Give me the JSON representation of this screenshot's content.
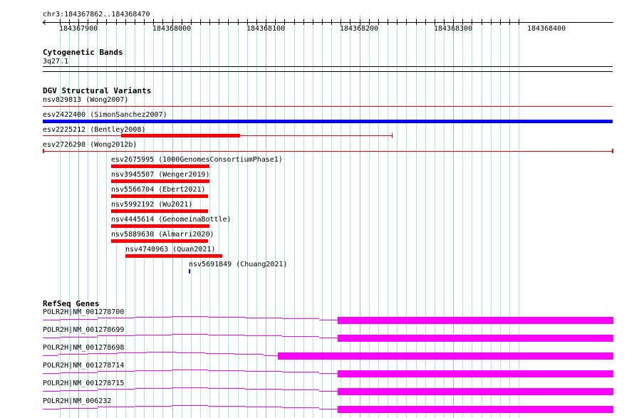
{
  "ruler": {
    "location": "chr3:184367862..184368470",
    "ticks": [
      "184367900",
      "184368000",
      "184368100",
      "184368200",
      "184368300",
      "184368400"
    ]
  },
  "cytobands": {
    "title": "Cytogenetic Bands",
    "band": "3q27.1"
  },
  "dgv": {
    "title": "DGV Structural Variants",
    "items": [
      {
        "label": "nsv829813 (Wong2007)",
        "color": "#ff0000"
      },
      {
        "label": "esv2422400 (SimonSanchez2007)",
        "color": "#0000ff"
      },
      {
        "label": "esv2225212 (Bentley2008)",
        "color": "#ff0000"
      },
      {
        "label": "esv2726298 (Wong2012b)",
        "color": "#ff0000"
      },
      {
        "label": "esv2675995 (1000GenomesConsortiumPhase1)",
        "color": "#ff0000"
      },
      {
        "label": "nsv3945507 (Wenger2019)",
        "color": "#ff0000"
      },
      {
        "label": "nsv5566704 (Ebert2021)",
        "color": "#ff0000"
      },
      {
        "label": "nsv5992192 (Wu2021)",
        "color": "#ff0000"
      },
      {
        "label": "nsv4445614 (GenomeinaBottle)",
        "color": "#ff0000"
      },
      {
        "label": "nsv5889630 (Almarri2020)",
        "color": "#ff0000"
      },
      {
        "label": "nsv4740963 (Quan2021)",
        "color": "#ff0000"
      },
      {
        "label": "nsv5691849 (Chuang2021)",
        "color": "#0000ff"
      }
    ]
  },
  "refseq": {
    "title": "RefSeq Genes",
    "color": "#ff00ff",
    "items": [
      {
        "label": "POLR2H|NM_001278700"
      },
      {
        "label": "POLR2H|NM_001278699"
      },
      {
        "label": "POLR2H|NM_001278698"
      },
      {
        "label": "POLR2H|NM_001278714"
      },
      {
        "label": "POLR2H|NM_001278715"
      },
      {
        "label": "POLR2H|NM_006232"
      }
    ]
  }
}
